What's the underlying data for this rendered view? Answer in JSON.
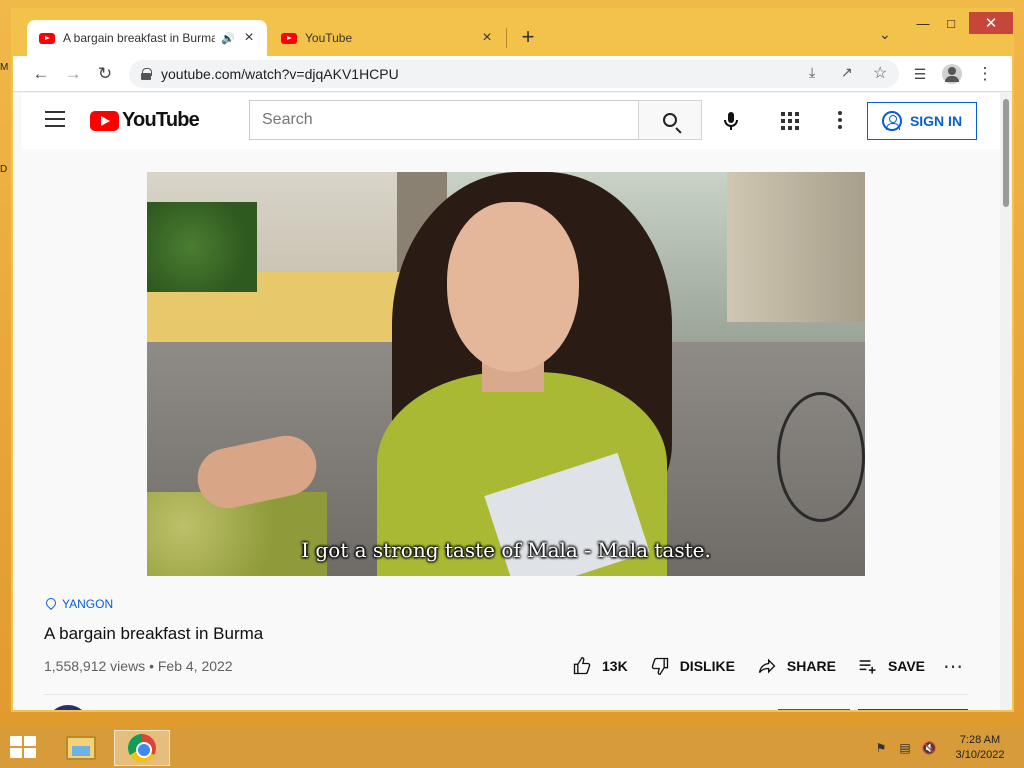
{
  "browser": {
    "tabs": [
      {
        "title": "A bargain breakfast in Burma",
        "active": true,
        "audio": true
      },
      {
        "title": "YouTube",
        "active": false,
        "audio": false
      }
    ],
    "new_tab_symbol": "+",
    "tab_search_symbol": "⌄",
    "url": "youtube.com/watch?v=djqAKV1HCPU",
    "window_controls": {
      "minimize": "🗕",
      "maximize": "🗖",
      "close": "✕"
    }
  },
  "youtube": {
    "logo_text": "YouTube",
    "search": {
      "placeholder": "Search",
      "value": ""
    },
    "sign_in_label": "SIGN IN"
  },
  "video": {
    "subtitle": "I got a strong taste of Mala - Mala taste.",
    "location": "YANGON",
    "title": "A bargain breakfast in Burma",
    "views_date": "1,558,912 views • Feb 4, 2022",
    "actions": {
      "like_count": "13K",
      "dislike_label": "DISLIKE",
      "share_label": "SHARE",
      "save_label": "SAVE"
    }
  },
  "taskbar": {
    "time": "7:28 AM",
    "date": "3/10/2022"
  },
  "desktop": {
    "edge_labels": [
      "M",
      "D"
    ]
  },
  "icons": {
    "back": "back-arrow-icon",
    "forward": "forward-arrow-icon",
    "reload": "reload-icon",
    "lock": "lock-icon",
    "download": "download-icon",
    "share": "share-icon",
    "bookmark": "star-icon",
    "media": "media-controls-icon",
    "profile": "profile-icon",
    "menu": "kebab-menu-icon"
  },
  "colors": {
    "youtube_red": "#ff0000",
    "link_blue": "#065fd4",
    "window_frame": "#f3c24a",
    "close_button": "#c7463a"
  }
}
